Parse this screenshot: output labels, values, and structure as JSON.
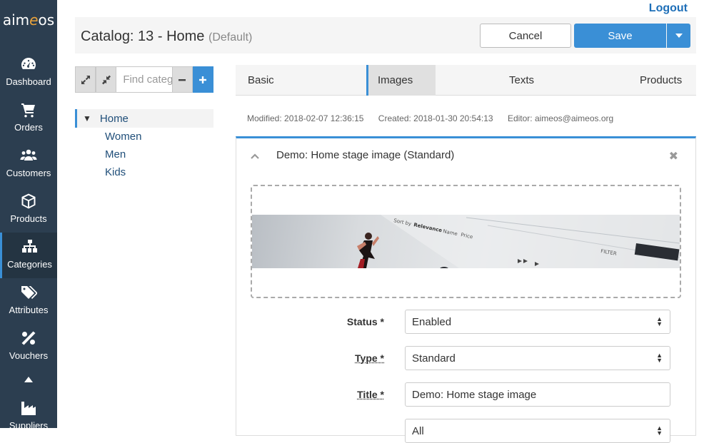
{
  "app": {
    "logo_pre": "aim",
    "logo_e": "e",
    "logo_post": "os"
  },
  "nav": [
    {
      "label": "Dashboard",
      "icon": "dashboard-icon"
    },
    {
      "label": "Orders",
      "icon": "cart-icon"
    },
    {
      "label": "Customers",
      "icon": "users-icon"
    },
    {
      "label": "Products",
      "icon": "cube-icon"
    },
    {
      "label": "Categories",
      "icon": "sitemap-icon",
      "active": true
    },
    {
      "label": "Attributes",
      "icon": "tags-icon"
    },
    {
      "label": "Vouchers",
      "icon": "percent-icon"
    },
    {
      "label": "Suppliers",
      "icon": "industry-icon"
    }
  ],
  "header": {
    "logout": "Logout",
    "title": "Catalog: 13 - Home",
    "title_suffix": "(Default)",
    "cancel": "Cancel",
    "save": "Save"
  },
  "tree": {
    "find_placeholder": "Find category",
    "root": "Home",
    "children": [
      "Women",
      "Men",
      "Kids"
    ]
  },
  "tabs": [
    "Basic",
    "Images",
    "Texts",
    "Products"
  ],
  "meta": {
    "modified": "Modified: 2018-02-07 12:36:15",
    "created": "Created: 2018-01-30 20:54:13",
    "editor": "Editor: aimeos@aimeos.org"
  },
  "item": {
    "title": "Demo: Home stage image (Standard)",
    "fields": {
      "status_label": "Status *",
      "status_value": "Enabled",
      "type_label": "Type *",
      "type_value": "Standard",
      "title_label": "Title *",
      "title_value": "Demo: Home stage image",
      "lang_value": "All"
    }
  },
  "preview_text": {
    "sortby": "Sort by",
    "relevance": "Relevance",
    "name": "Name",
    "price": "Price",
    "filter": "FILTER"
  },
  "colors": {
    "sidebar": "#2c3e50",
    "accent": "#3a8fd6",
    "link": "#1e6fb8"
  }
}
